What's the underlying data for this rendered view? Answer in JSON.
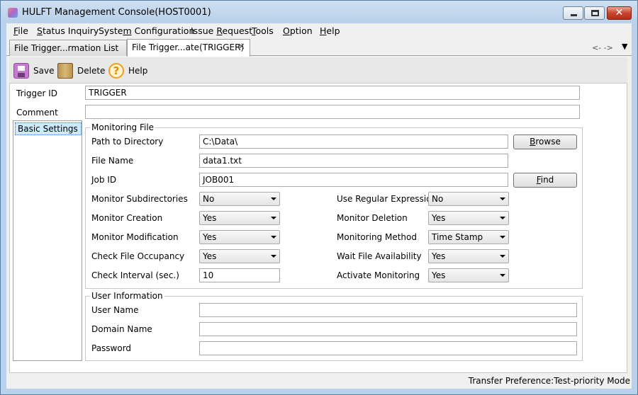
{
  "window": {
    "title": "HULFT Management Console(HOST0001)"
  },
  "menu": [
    {
      "label": "File",
      "accel": "F",
      "rest": "ile"
    },
    {
      "label": "Status Inquiry",
      "accel": "S",
      "rest": "tatus Inquiry"
    },
    {
      "label": "System Configuration",
      "pre": "Syste",
      "accel": "m",
      "rest": " Configuration"
    },
    {
      "label": "Issue Request",
      "pre": "Issue ",
      "accel": "R",
      "rest": "equest"
    },
    {
      "label": "Tools",
      "accel": "T",
      "rest": "ools"
    },
    {
      "label": "Option",
      "accel": "O",
      "rest": "ption"
    },
    {
      "label": "Help",
      "accel": "H",
      "rest": "elp"
    }
  ],
  "tabs": [
    {
      "label": "File Trigger...rmation List"
    },
    {
      "label": "File Trigger...ate(TRIGGER)"
    }
  ],
  "tab_nav": {
    "arrows": "<-  ->",
    "menu": "▼"
  },
  "toolbar": {
    "save": "Save",
    "delete": "Delete",
    "help": "Help"
  },
  "form": {
    "trigger_id_label": "Trigger ID",
    "trigger_id": "TRIGGER",
    "comment_label": "Comment",
    "comment": ""
  },
  "sidebar": {
    "items": [
      "Basic Settings"
    ]
  },
  "monitoring": {
    "title": "Monitoring File",
    "path_label": "Path to Directory",
    "path": "C:\\Data\\",
    "browse": "Browse",
    "browse_accel": "B",
    "browse_rest": "rowse",
    "file_label": "File Name",
    "file": "data1.txt",
    "job_label": "Job ID",
    "job": "JOB001",
    "find": "Find",
    "find_accel": "F",
    "find_rest": "ind",
    "subdir_label": "Monitor Subdirectories",
    "subdir": "No",
    "regex_label": "Use Regular Expression",
    "regex": "No",
    "creation_label": "Monitor Creation",
    "creation": "Yes",
    "deletion_label": "Monitor Deletion",
    "deletion": "Yes",
    "modification_label": "Monitor Modification",
    "modification": "Yes",
    "method_label": "Monitoring Method",
    "method": "Time Stamp",
    "occupancy_label": "Check File Occupancy",
    "occupancy": "Yes",
    "wait_label": "Wait File Availability",
    "wait": "Yes",
    "interval_label": "Check Interval (sec.)",
    "interval": "10",
    "activate_label": "Activate Monitoring",
    "activate": "Yes"
  },
  "user_info": {
    "title": "User Information",
    "user_label": "User Name",
    "user": "",
    "domain_label": "Domain Name",
    "domain": "",
    "password_label": "Password",
    "password": ""
  },
  "status": {
    "text": "Transfer Preference:Test-priority Mode"
  }
}
